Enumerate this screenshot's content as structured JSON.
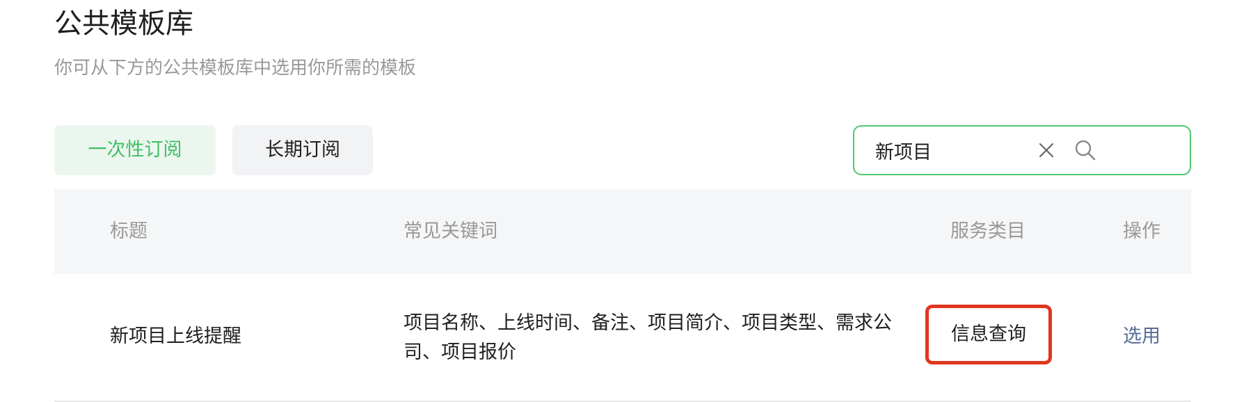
{
  "header": {
    "title": "公共模板库",
    "subtitle": "你可从下方的公共模板库中选用你所需的模板"
  },
  "tabs": [
    {
      "label": "一次性订阅",
      "active": true
    },
    {
      "label": "长期订阅",
      "active": false
    }
  ],
  "search": {
    "value": "新项目",
    "placeholder": ""
  },
  "table": {
    "columns": [
      "标题",
      "常见关键词",
      "服务类目",
      "操作"
    ],
    "rows": [
      {
        "title": "新项目上线提醒",
        "keywords": "项目名称、上线时间、备注、项目简介、项目类型、需求公司、项目报价",
        "category": "信息查询",
        "action": "选用"
      }
    ]
  },
  "colors": {
    "accent": "#3fbf66",
    "tab_active_bg": "#ebf7ee",
    "link": "#576b95",
    "highlight_border": "#e0361f"
  }
}
